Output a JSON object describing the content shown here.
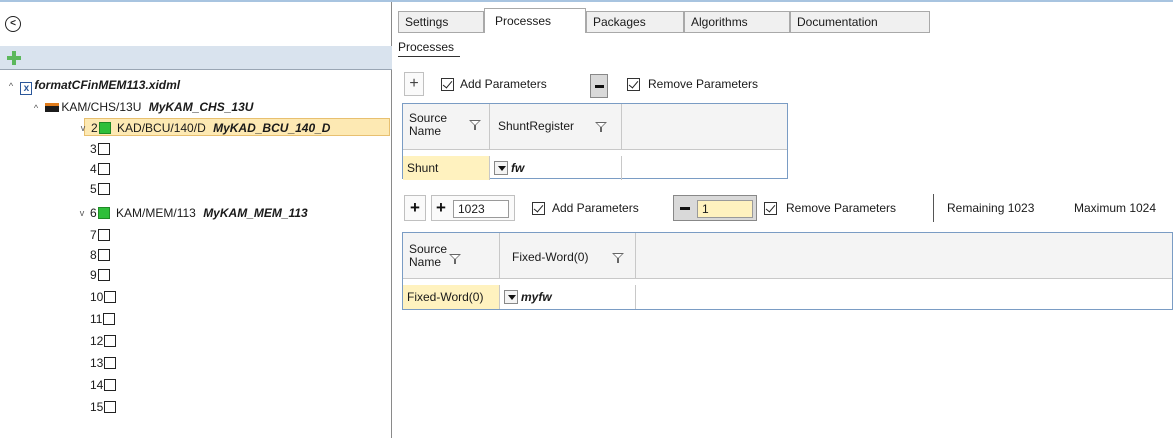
{
  "left_panel": {
    "collapse_glyph": "<",
    "tree": {
      "root": {
        "name": "formatCFinMEM113.xidml"
      },
      "chassis": {
        "type": "KAM/CHS/13U",
        "name": "MyKAM_CHS_13U"
      },
      "slots": [
        {
          "slot": "2",
          "type": "KAD/BCU/140/D",
          "name": "MyKAD_BCU_140_D",
          "occupied": true,
          "selected": true
        },
        {
          "slot": "3"
        },
        {
          "slot": "4"
        },
        {
          "slot": "5"
        },
        {
          "slot": "6",
          "type": "KAM/MEM/113",
          "name": "MyKAM_MEM_113",
          "occupied": true
        },
        {
          "slot": "7"
        },
        {
          "slot": "8"
        },
        {
          "slot": "9"
        },
        {
          "slot": "10"
        },
        {
          "slot": "11"
        },
        {
          "slot": "12"
        },
        {
          "slot": "13"
        },
        {
          "slot": "14"
        },
        {
          "slot": "15"
        }
      ]
    }
  },
  "tabs": [
    {
      "label": "Settings",
      "active": false
    },
    {
      "label": "Processes",
      "active": true
    },
    {
      "label": "Packages",
      "active": false
    },
    {
      "label": "Algorithms",
      "active": false
    },
    {
      "label": "Documentation",
      "active": false
    }
  ],
  "processes": {
    "section_title": "Processes",
    "block1": {
      "add_params_label": "Add Parameters",
      "remove_params_label": "Remove Parameters",
      "columns": [
        "Source Name",
        "ShuntRegister"
      ],
      "column0_line1": "Source",
      "column0_line2": "Name",
      "rows": [
        {
          "source": "Shunt",
          "value": "fw"
        }
      ]
    },
    "block2": {
      "add_count": "1023",
      "add_params_label": "Add Parameters",
      "remove_count": "1",
      "remove_params_label": "Remove Parameters",
      "remaining_label": "Remaining 1023",
      "maximum_label": "Maximum 1024",
      "column0_line1": "Source",
      "column0_line2": "Name",
      "column1": "Fixed-Word(0)",
      "rows": [
        {
          "source": "Fixed-Word(0)",
          "value": "myfw"
        }
      ]
    }
  },
  "colors": {
    "selected_row": "#fde9b3",
    "editable_cell": "#fff2bf",
    "occupied_slot": "#2fbf3a",
    "add_icon": "#5cb85c"
  }
}
